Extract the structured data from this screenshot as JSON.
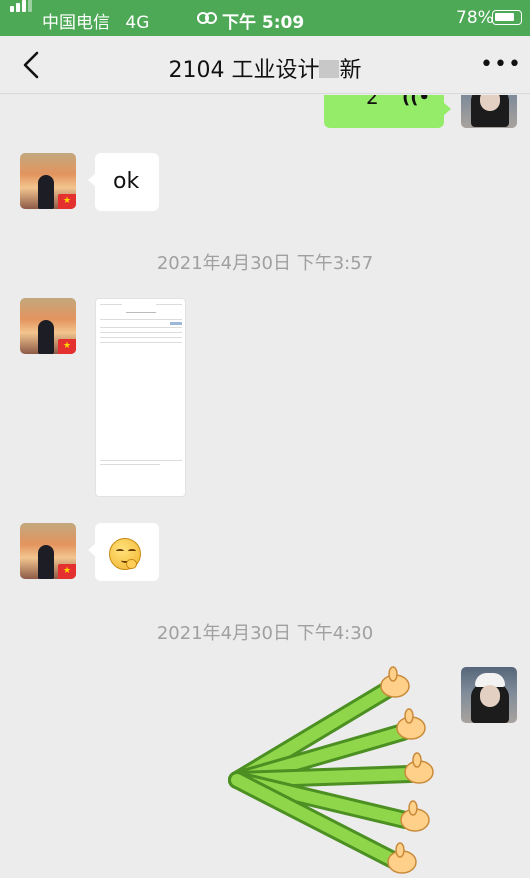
{
  "status_bar": {
    "carrier": "中国电信",
    "network": "4G",
    "time": "下午 5:09",
    "battery": "78%"
  },
  "nav": {
    "title": "2104 工业设计",
    "title_suffix": "新",
    "back_icon": "chevron-left-icon",
    "more_icon": "more-icon"
  },
  "messages": {
    "voice_duration": "2\"",
    "ok_text": "ok",
    "timestamp1": "2021年4月30日 下午3:57",
    "timestamp2": "2021年4月30日 下午4:30"
  },
  "colors": {
    "status_bar_bg": "#4ea957",
    "bubble_green": "#95ec69",
    "chat_bg": "#ececec"
  }
}
